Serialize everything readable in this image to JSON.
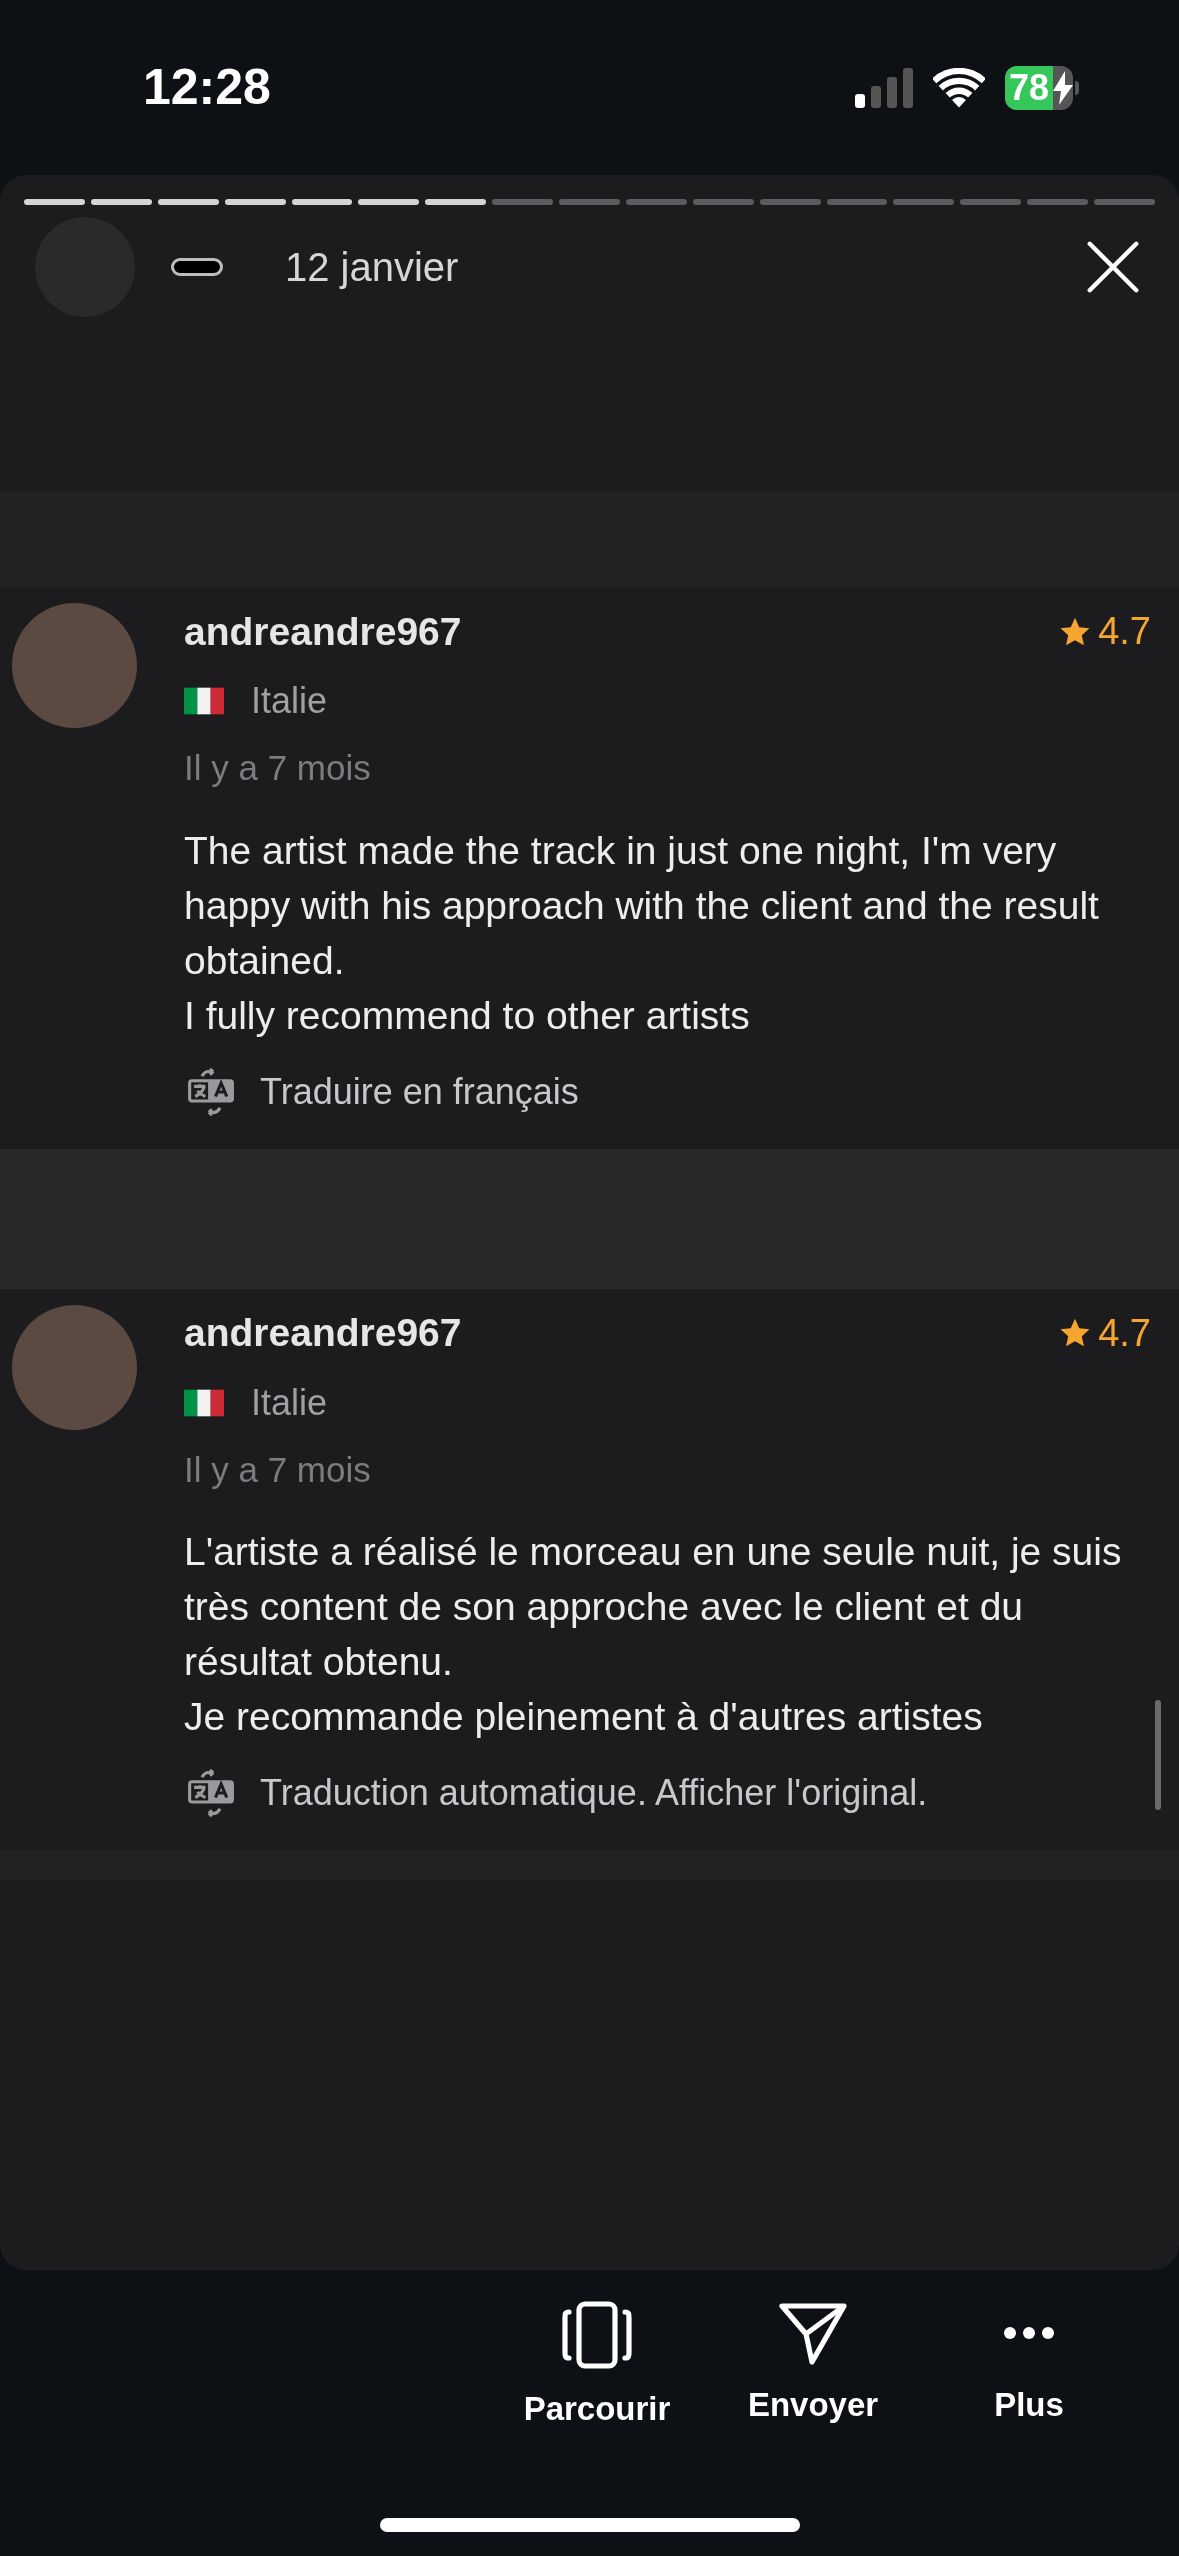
{
  "status_bar": {
    "time": "12:28",
    "battery": "78"
  },
  "story": {
    "segments": [
      {
        "viewed": true
      },
      {
        "viewed": true
      },
      {
        "viewed": true
      },
      {
        "viewed": true
      },
      {
        "viewed": true
      },
      {
        "viewed": true
      },
      {
        "viewed": true
      },
      {
        "viewed": false
      },
      {
        "viewed": false
      },
      {
        "viewed": false
      },
      {
        "viewed": false
      },
      {
        "viewed": false
      },
      {
        "viewed": false
      },
      {
        "viewed": false
      },
      {
        "viewed": false
      },
      {
        "viewed": false
      },
      {
        "viewed": false
      }
    ],
    "date": "12 janvier"
  },
  "reviews": [
    {
      "username": "andreandre967",
      "rating": "4.7",
      "country": "Italie",
      "time": "Il y a 7 mois",
      "text": "The artist made the track in just one night, I'm very happy with his approach with the client and the result obtained.\nI fully recommend to other artists",
      "translation_link": "Traduire en français"
    },
    {
      "username": "andreandre967",
      "rating": "4.7",
      "country": "Italie",
      "time": "Il y a 7 mois",
      "text": "L'artiste a réalisé le morceau en une seule nuit, je suis très content de son approche avec le client et du résultat obtenu.\nJe recommande pleinement à d'autres artistes",
      "translation_link": "Traduction automatique. Afficher l'original."
    }
  ],
  "actions": [
    {
      "kind": "browse",
      "label": "Parcourir"
    },
    {
      "kind": "send",
      "label": "Envoyer"
    },
    {
      "kind": "more",
      "label": "Plus"
    }
  ]
}
